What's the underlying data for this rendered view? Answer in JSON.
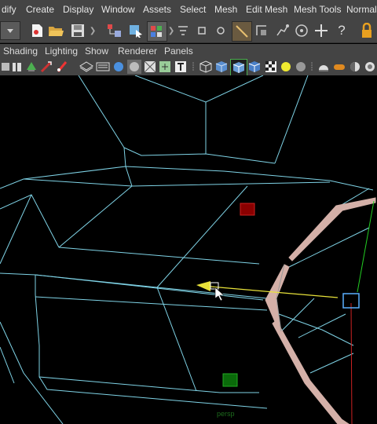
{
  "menus": [
    "dify",
    "Create",
    "Display",
    "Window",
    "Assets",
    "Select",
    "Mesh",
    "Edit Mesh",
    "Mesh Tools",
    "Normals"
  ],
  "panel_menus": [
    "Shading",
    "Lighting",
    "Show",
    "Renderer",
    "Panels"
  ],
  "status_icons": [
    "dropdown-arrow",
    "new-scene",
    "open-scene",
    "save-scene",
    "select-by-hierarchy",
    "select-by-object",
    "select-by-component",
    "snap-to-grid",
    "snap-to-curve",
    "snap-to-point",
    "snap-to-projected-center",
    "snap-to-view-plane",
    "make-live",
    "construction-history",
    "move-tool",
    "help",
    "lock"
  ],
  "panel_tools": [
    "camera-attributes",
    "bookmarks",
    "image-plane",
    "2d-pan-zoom",
    "grid",
    "film-gate",
    "resolution-gate",
    "gate-mask",
    "field-chart",
    "safe-action",
    "safe-title",
    "wireframe",
    "smooth-shade",
    "wireframe-on-shaded",
    "textured",
    "use-all-lights",
    "shadows",
    "ambient-occlusion",
    "motion-blur"
  ],
  "viewport_label": "persp",
  "colors": {
    "wire": "#7fd3e6",
    "selected_edge": "#e6b8a8",
    "manip_yellow": "#e8e23a",
    "manip_red": "#cc2222",
    "manip_green": "#22cc22",
    "manip_blue": "#5ab0ff"
  }
}
